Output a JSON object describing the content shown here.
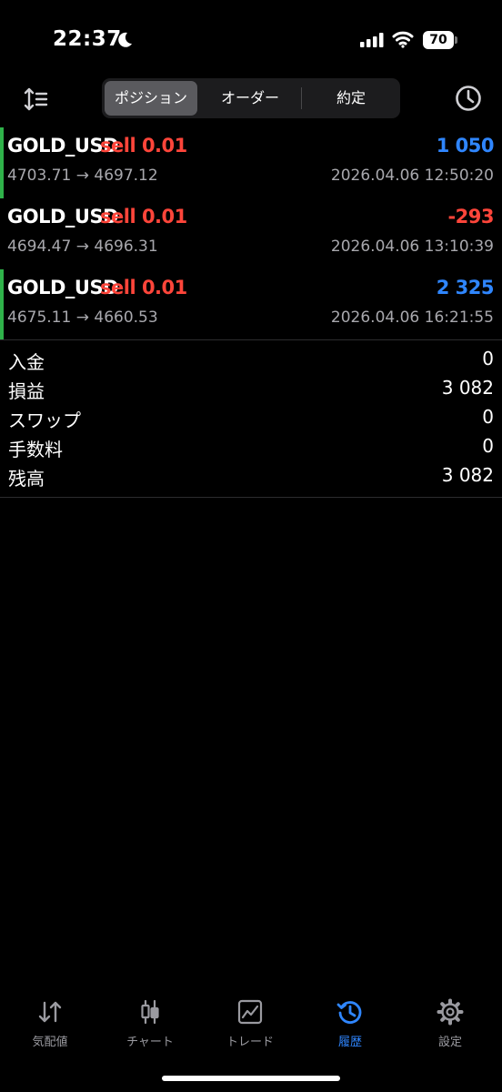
{
  "status_bar": {
    "time": "22:37",
    "battery": "70"
  },
  "toolbar": {
    "tabs": [
      {
        "label": "ポジション",
        "active": true
      },
      {
        "label": "オーダー",
        "active": false
      },
      {
        "label": "約定",
        "active": false
      }
    ],
    "icons": [
      "sort-icon",
      "clock-history-icon"
    ]
  },
  "positions": [
    {
      "symbol": "GOLD_USD",
      "side": "sell 0.01",
      "profit": "1 050",
      "profit_color": "#2f86ff",
      "open_price": "4703.71",
      "close_price": "4697.12",
      "time": "2026.04.06 12:50:20",
      "indicator": true
    },
    {
      "symbol": "GOLD_USD",
      "side": "sell 0.01",
      "profit": "-293",
      "profit_color": "#ff453a",
      "open_price": "4694.47",
      "close_price": "4696.31",
      "time": "2026.04.06 13:10:39",
      "indicator": false
    },
    {
      "symbol": "GOLD_USD",
      "side": "sell 0.01",
      "profit": "2 325",
      "profit_color": "#2f86ff",
      "open_price": "4675.11",
      "close_price": "4660.53",
      "time": "2026.04.06 16:21:55",
      "indicator": true
    }
  ],
  "summary": [
    {
      "label": "入金",
      "value": "0"
    },
    {
      "label": "損益",
      "value": "3 082"
    },
    {
      "label": "スワップ",
      "value": "0"
    },
    {
      "label": "手数料",
      "value": "0"
    },
    {
      "label": "残高",
      "value": "3 082"
    }
  ],
  "tabbar": [
    {
      "label": "気配値",
      "icon": "arrows-updown-icon",
      "active": false
    },
    {
      "label": "チャート",
      "icon": "candlestick-icon",
      "active": false
    },
    {
      "label": "トレード",
      "icon": "trade-chart-icon",
      "active": false
    },
    {
      "label": "履歴",
      "icon": "history-icon",
      "active": true
    },
    {
      "label": "設定",
      "icon": "gear-icon",
      "active": false
    }
  ],
  "colors": {
    "accent": "#2f86ff",
    "loss": "#ff453a",
    "indicator": "#2fb24a",
    "background": "#000000"
  }
}
